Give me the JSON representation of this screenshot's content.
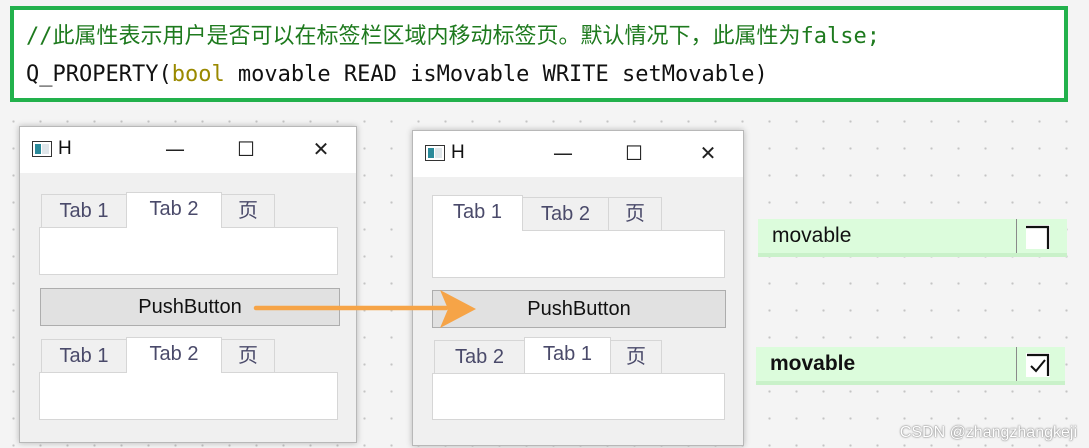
{
  "code": {
    "comment": "//此属性表示用户是否可以在标签栏区域内移动标签页。默认情况下，此属性为false;",
    "macro": "Q_PROPERTY(",
    "type": "bool",
    "rest": " movable READ isMovable WRITE setMovable)"
  },
  "window_left": {
    "title": "H",
    "top_tabs": [
      "Tab 1",
      "Tab 2",
      "页"
    ],
    "top_active_index": 1,
    "button_label": "PushButton",
    "bottom_tabs": [
      "Tab 1",
      "Tab 2",
      "页"
    ],
    "bottom_active_index": 1
  },
  "window_right": {
    "title": "H",
    "top_tabs": [
      "Tab 1",
      "Tab 2",
      "页"
    ],
    "top_active_index": 0,
    "button_label": "PushButton",
    "bottom_tabs": [
      "Tab 2",
      "Tab 1",
      "页"
    ],
    "bottom_active_index": 1
  },
  "titlebar_buttons": {
    "minimize": "—",
    "maximize": "☐",
    "close": "✕"
  },
  "property_rows": [
    {
      "name": "movable",
      "checked": false
    },
    {
      "name": "movable",
      "checked": true
    }
  ],
  "watermark": "CSDN @zhangzhangkeji",
  "colors": {
    "code_border": "#22b14c",
    "comment": "#1e7a1e",
    "keyword": "#9a8900",
    "arrow": "#f6a447",
    "property_bg": "#dcfcdc"
  }
}
